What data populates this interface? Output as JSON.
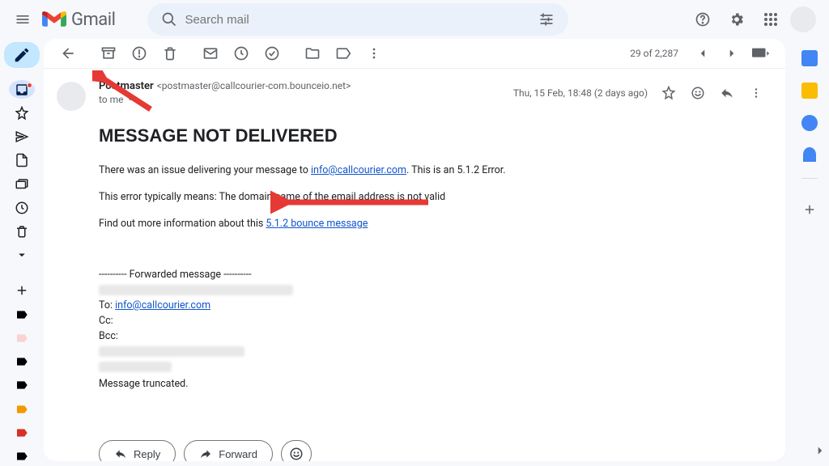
{
  "header": {
    "product": "Gmail",
    "search_placeholder": "Search mail"
  },
  "toolbar": {
    "pager": "29 of 2,287"
  },
  "message": {
    "sender_name": "Postmaster",
    "sender_email": "<postmaster@callcourier-com.bounceio.net>",
    "to_line": "to me",
    "date": "Thu, 15 Feb, 18:48 (2 days ago)",
    "subject": "MESSAGE NOT DELIVERED",
    "body": {
      "p1_pre": "There was an issue delivering your message to ",
      "p1_link": "info@callcourier.com",
      "p1_post": ". This is an 5.1.2 Error.",
      "p2": "This error typically means: The domain name of the email address is not valid",
      "p3_pre": "Find out more information about this ",
      "p3_link": "5.1.2 bounce message",
      "fwd_sep": "---------- Forwarded message ----------",
      "to_lbl": "To: ",
      "to_val": "info@callcourier.com",
      "cc_lbl": "Cc:",
      "bcc_lbl": "Bcc:",
      "truncated": "Message truncated."
    }
  },
  "actions": {
    "reply": "Reply",
    "forward": "Forward"
  }
}
